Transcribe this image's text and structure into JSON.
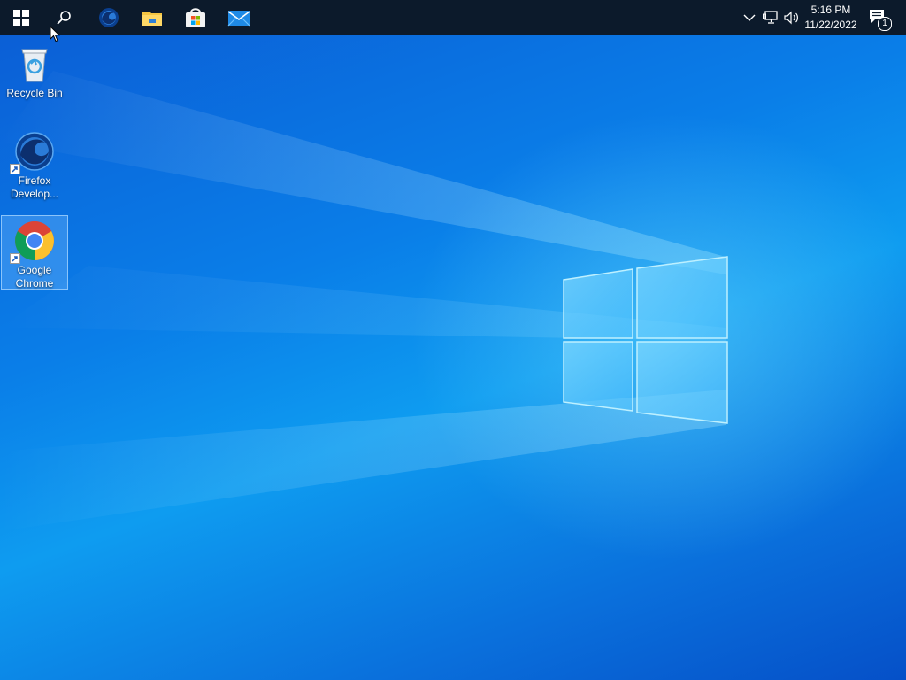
{
  "taskbar": {
    "start_icon": "windows-logo-icon",
    "search_icon": "search-icon",
    "pinned_apps": [
      {
        "name": "firefox-developer-icon"
      },
      {
        "name": "file-explorer-icon"
      },
      {
        "name": "microsoft-store-icon"
      },
      {
        "name": "mail-icon"
      }
    ],
    "tray": {
      "chevron_icon": "chevron-up-icon",
      "network_icon": "network-icon",
      "volume_icon": "volume-icon",
      "time": "5:16 PM",
      "date": "11/22/2022",
      "notification_icon": "action-center-icon",
      "notification_count": "1"
    }
  },
  "desktop": {
    "icons": [
      {
        "label": "Recycle Bin",
        "icon": "recycle-bin-icon",
        "shortcut": false,
        "selected": false
      },
      {
        "label": "Firefox Develop...",
        "icon": "firefox-developer-icon",
        "shortcut": true,
        "selected": false
      },
      {
        "label": "Google Chrome",
        "icon": "chrome-icon",
        "shortcut": true,
        "selected": true
      }
    ]
  },
  "colors": {
    "taskbar": "#0c1a2b",
    "wallpaper_primary": "#0a7ee8",
    "selection": "#78beff"
  }
}
